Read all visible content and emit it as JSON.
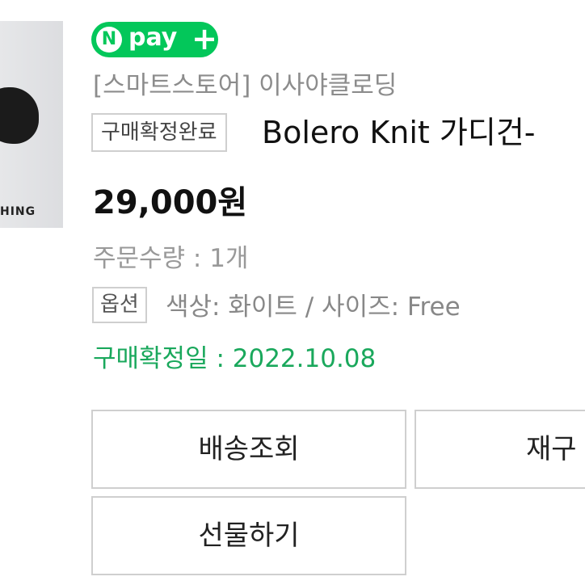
{
  "product_image": {
    "caption": "HING"
  },
  "payment_badge": {
    "n_letter": "N",
    "pay_text": "pay",
    "plus_text": "+",
    "color": "#03c75a"
  },
  "order": {
    "store_name": "[스마트스토어] 이사야클로딩",
    "status_badge": "구매확정완료",
    "product_title": "Bolero Knit 가디건-",
    "price": "29,000원",
    "quantity": "주문수량 : 1개",
    "option_label": "옵션",
    "option_value": "색상: 화이트 / 사이즈: Free",
    "confirm_date": "구매확정일 : 2022.10.08",
    "confirm_color": "#1aa85c"
  },
  "actions": {
    "track_label": "배송조회",
    "rebuy_label": "재구",
    "gift_label": "선물하기"
  }
}
